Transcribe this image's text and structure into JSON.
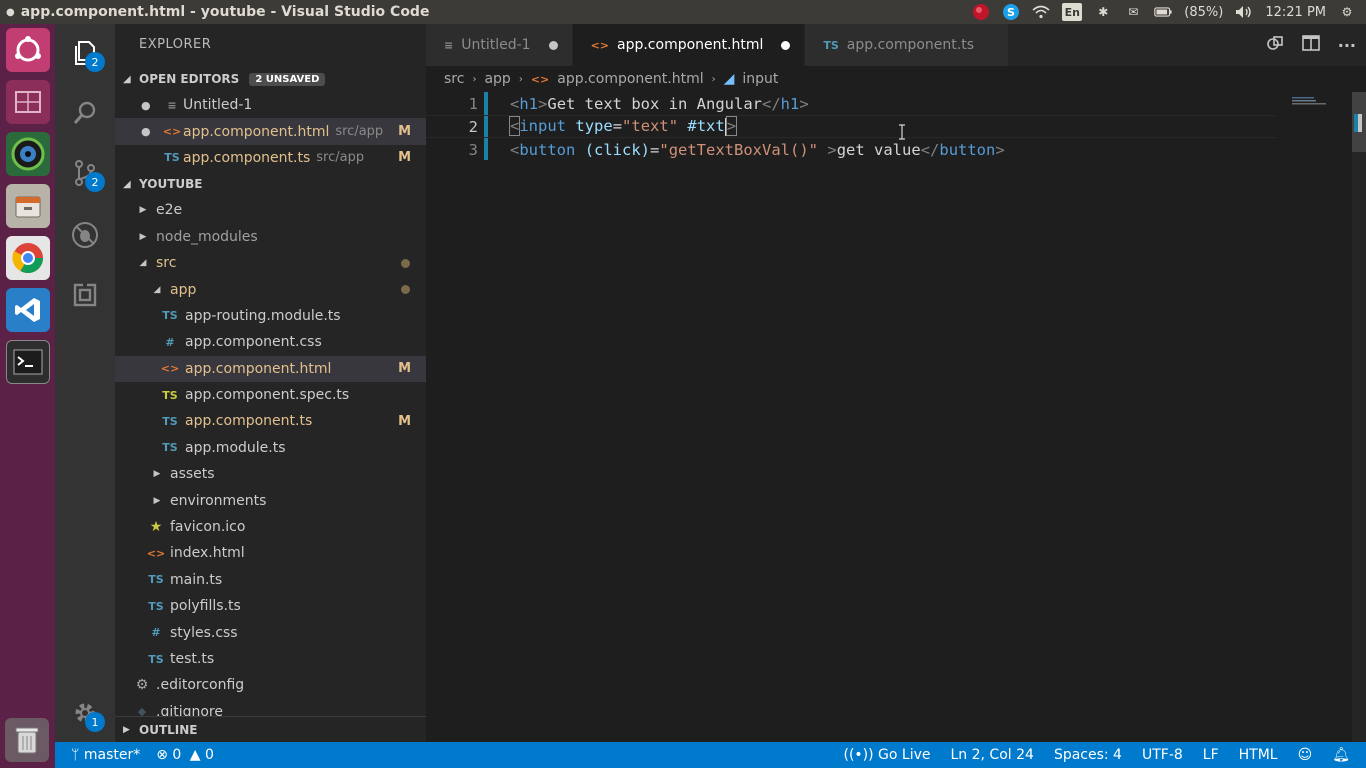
{
  "window": {
    "title": "app.component.html - youtube - Visual Studio Code"
  },
  "system_tray": {
    "battery": "(85%)",
    "time": "12:21 PM",
    "keyboard": "En"
  },
  "sidebar": {
    "title": "EXPLORER",
    "open_editors": {
      "label": "OPEN EDITORS",
      "unsaved": "2 UNSAVED",
      "items": [
        {
          "icon": "≡",
          "name": "Untitled-1",
          "path": "",
          "mark": ""
        },
        {
          "icon": "<>",
          "name": "app.component.html",
          "path": "src/app",
          "mark": "M"
        },
        {
          "icon": "TS",
          "name": "app.component.ts",
          "path": "src/app",
          "mark": "M"
        }
      ]
    },
    "project": {
      "label": "YOUTUBE",
      "tree": [
        {
          "name": "e2e"
        },
        {
          "name": "node_modules"
        },
        {
          "name": "src"
        },
        {
          "name": "app"
        },
        {
          "name": "app-routing.module.ts",
          "icon": "TS"
        },
        {
          "name": "app.component.css",
          "icon": "#"
        },
        {
          "name": "app.component.html",
          "icon": "<>",
          "mark": "M"
        },
        {
          "name": "app.component.spec.ts",
          "icon": "TS"
        },
        {
          "name": "app.component.ts",
          "icon": "TS",
          "mark": "M"
        },
        {
          "name": "app.module.ts",
          "icon": "TS"
        },
        {
          "name": "assets"
        },
        {
          "name": "environments"
        },
        {
          "name": "favicon.ico",
          "icon": "★"
        },
        {
          "name": "index.html",
          "icon": "<>"
        },
        {
          "name": "main.ts",
          "icon": "TS"
        },
        {
          "name": "polyfills.ts",
          "icon": "TS"
        },
        {
          "name": "styles.css",
          "icon": "#"
        },
        {
          "name": "test.ts",
          "icon": "TS"
        },
        {
          "name": ".editorconfig",
          "icon": "⚙"
        },
        {
          "name": ".gitignore",
          "icon": "◆"
        }
      ]
    },
    "outline_label": "OUTLINE"
  },
  "activity": {
    "explorer_badge": "2",
    "scm_badge": "2",
    "settings_badge": "1"
  },
  "tabs": [
    {
      "icon": "≡",
      "label": "Untitled-1"
    },
    {
      "icon": "<>",
      "label": "app.component.html"
    },
    {
      "icon": "TS",
      "label": "app.component.ts"
    }
  ],
  "breadcrumb": {
    "a": "src",
    "b": "app",
    "c": "app.component.html",
    "d": "input"
  },
  "editor": {
    "line_numbers": [
      "1",
      "2",
      "3"
    ],
    "line1": {
      "open_tag": "h1",
      "text": "Get text box in Angular",
      "close_tag": "h1"
    },
    "line2": {
      "tag": "input",
      "attr": "type",
      "value": "\"text\"",
      "ref": "#txt"
    },
    "line3": {
      "tag": "button",
      "attr": "(click)",
      "value": "\"getTextBoxVal()\"",
      "text": "get value",
      "close_tag": "button"
    }
  },
  "statusbar": {
    "branch": "master*",
    "errors": "0",
    "warnings": "0",
    "golive": "Go Live",
    "position": "Ln 2, Col 24",
    "spaces": "Spaces: 4",
    "encoding": "UTF-8",
    "eol": "LF",
    "language": "HTML"
  }
}
